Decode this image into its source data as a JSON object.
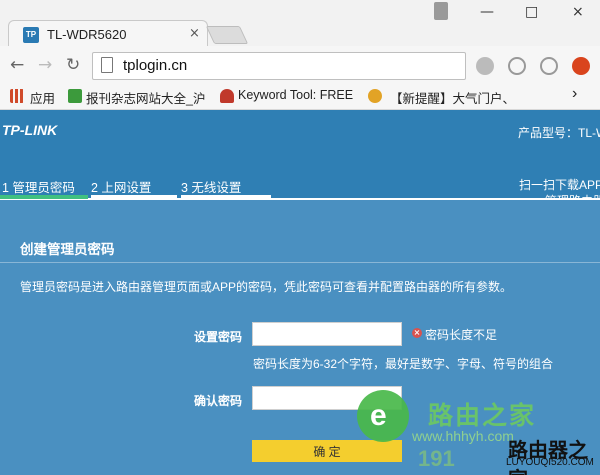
{
  "browser": {
    "tab_title": "TL-WDR5620",
    "tab_favicon": "TP",
    "tab_close": "×",
    "window_buttons": [
      "—",
      "□",
      "×"
    ],
    "nav": {
      "back": "←",
      "forward": "→",
      "reload": "↻"
    },
    "address": "tplogin.cn",
    "bookmarks": [
      {
        "label": "应用",
        "color": "#d04a2a"
      },
      {
        "label": "报刊杂志网站大全_沪",
        "color": "#3c9a3c"
      },
      {
        "label": "Keyword Tool: FREE",
        "color": "#c0392b"
      },
      {
        "label": "【新提醒】大气门户、",
        "color": "#e2a326"
      }
    ],
    "bookmarks_more": "›"
  },
  "router": {
    "logo": "TP-LINK",
    "model_label": "产品型号：TL-W",
    "qr_line1": "扫一扫下载APP",
    "qr_line2": "管理路由器",
    "steps": [
      {
        "label": "1 管理员密码",
        "active": true
      },
      {
        "label": "2 上网设置",
        "active": false
      },
      {
        "label": "3 无线设置",
        "active": false
      }
    ],
    "panel": {
      "title": "创建管理员密码",
      "description": "管理员密码是进入路由器管理页面或APP的密码，凭此密码可查看并配置路由器的所有参数。",
      "set_password_label": "设置密码",
      "set_password_value": "",
      "error_icon": "×",
      "error_text": "密码长度不足",
      "hint": "密码长度为6-32个字符，最好是数字、字母、符号的组合",
      "confirm_password_label": "确认密码",
      "confirm_password_value": "",
      "confirm_button": "确 定"
    },
    "colors": {
      "header": "#2f7fb4",
      "panel": "#4a90c1",
      "button": "#f4ce2e",
      "active_step": "#40c080"
    }
  },
  "watermark": {
    "glyph": "e",
    "name": "路由之家",
    "url": "www.hhhyh.com",
    "number": "191",
    "brand": "路由器之家",
    "brand_url": "LUYOUQI520.COM"
  }
}
